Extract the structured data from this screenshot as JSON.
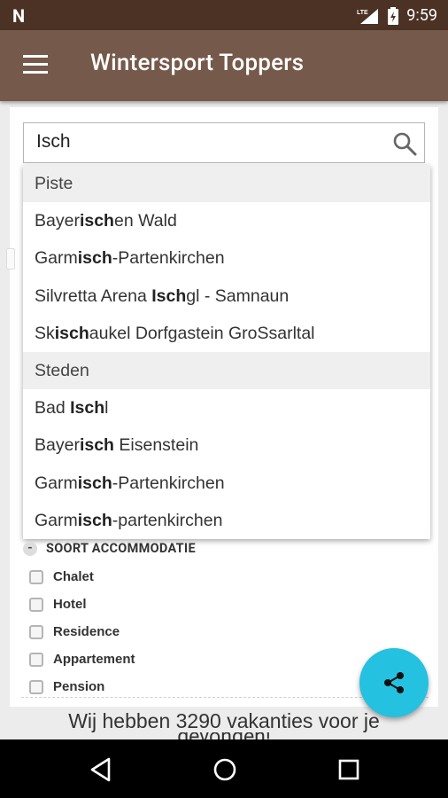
{
  "status_bar": {
    "notification_icon": "N",
    "network_label": "LTE",
    "time": "9:59"
  },
  "app_bar": {
    "title": "Wintersport Toppers"
  },
  "search": {
    "value": "Isch",
    "placeholder": ""
  },
  "dropdown": {
    "items": [
      {
        "type": "header",
        "label": "Piste"
      },
      {
        "type": "option",
        "pre": "Bayer",
        "match": "isch",
        "post": "en Wald"
      },
      {
        "type": "option",
        "pre": "Garm",
        "match": "isch",
        "post": "-Partenkirchen"
      },
      {
        "type": "option",
        "pre": "Silvretta Arena ",
        "match": "Isch",
        "post": "gl - Samnaun"
      },
      {
        "type": "option",
        "pre": "Sk",
        "match": "isch",
        "post": "aukel Dorfgastein GroSsarltal"
      },
      {
        "type": "header",
        "label": "Steden"
      },
      {
        "type": "option",
        "pre": "Bad ",
        "match": "Isch",
        "post": "l"
      },
      {
        "type": "option",
        "pre": "Bayer",
        "match": "isch",
        "post": " Eisenstein"
      },
      {
        "type": "option",
        "pre": "Garm",
        "match": "isch",
        "post": "-Partenkirchen"
      },
      {
        "type": "option",
        "pre": "Garm",
        "match": "isch",
        "post": "-partenkirchen"
      }
    ]
  },
  "accommodation": {
    "heading": "SOORT ACCOMMODATIE",
    "options": [
      "Chalet",
      "Hotel",
      "Residence",
      "Appartement",
      "Pension"
    ]
  },
  "results": {
    "text": "Wij hebben 3290 vakanties voor je",
    "text_cutoff": "gevonden!"
  },
  "colors": {
    "status_bar": "#4b3224",
    "app_bar": "#75594a",
    "fab": "#24c1e0"
  },
  "icons": {
    "menu": "hamburger-icon",
    "search": "search-icon",
    "share": "share-icon",
    "back": "back-icon",
    "home": "home-icon",
    "recents": "recents-icon"
  }
}
